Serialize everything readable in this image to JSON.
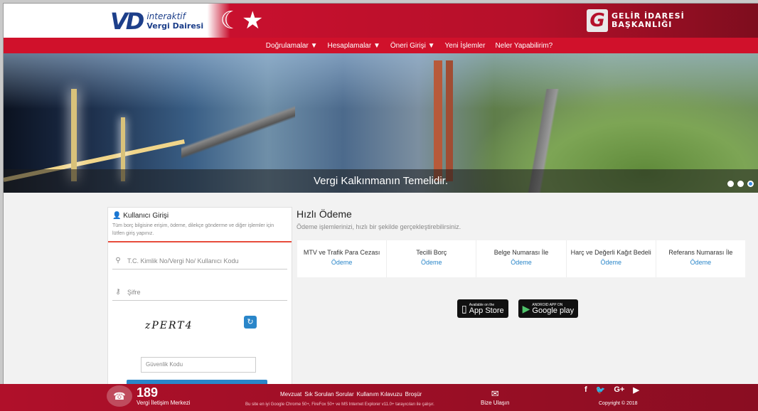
{
  "header": {
    "logo_mark": "VD",
    "logo_line1": "interaktif",
    "logo_line2": "Vergi Dairesi",
    "gib_icon": "G",
    "gib_line1": "GELİR İDARESİ",
    "gib_line2": "BAŞKANLIĞI"
  },
  "nav": {
    "items": [
      {
        "label": "Doğrulamalar ▼"
      },
      {
        "label": "Hesaplamalar ▼"
      },
      {
        "label": "Öneri Girişi ▼"
      },
      {
        "label": "Yeni İşlemler"
      },
      {
        "label": "Neler Yapabilirim?"
      }
    ]
  },
  "banner": {
    "caption": "Vergi Kalkınmanın Temelidir.",
    "active_slide": 3
  },
  "login": {
    "title": "Kullanıcı Girişi",
    "description": "Tüm borç bilgisine erişim, ödeme, dilekçe gönderme ve diğer işlemler için lütfen giriş yapınız.",
    "user_placeholder": "T.C. Kimlik No/Vergi No/ Kullanıcı Kodu",
    "password_placeholder": "Şifre",
    "captcha": "zPERT4",
    "security_placeholder": "Güvenlik Kodu"
  },
  "quick_pay": {
    "title": "Hızlı Ödeme",
    "subtitle": "Ödeme işlemlerinizi, hızlı bir şekilde gerçekleştirebilirsiniz.",
    "items": [
      {
        "name": "MTV ve Trafik Para Cezası",
        "link": "Ödeme"
      },
      {
        "name": "Tecilli Borç",
        "link": "Ödeme"
      },
      {
        "name": "Belge Numarası İle",
        "link": "Ödeme"
      },
      {
        "name": "Harç ve Değerli Kağıt Bedeli",
        "link": "Ödeme"
      },
      {
        "name": "Referans Numarası İle",
        "link": "Ödeme"
      }
    ]
  },
  "stores": {
    "appstore_small": "Available on the",
    "appstore_big": "App Store",
    "google_small": "ANDROID APP ON",
    "google_big": "Google play"
  },
  "footer": {
    "phone": "189",
    "phone_label": "Vergi İletişim Merkezi",
    "links": [
      "Mevzuat",
      "Sık Sorulan Sorular",
      "Kullanım Kılavuzu",
      "Broşür"
    ],
    "note": "Bu site en iyi Google Chrome 50+, FireFox 50+ ve MS Internet Explorer v11.0+ tarayıcıları ile çalışır.",
    "contact": "Bize Ulaşın",
    "social": [
      "f",
      "🐦",
      "G+",
      "▶"
    ],
    "copyright": "Copyright © 2018"
  }
}
